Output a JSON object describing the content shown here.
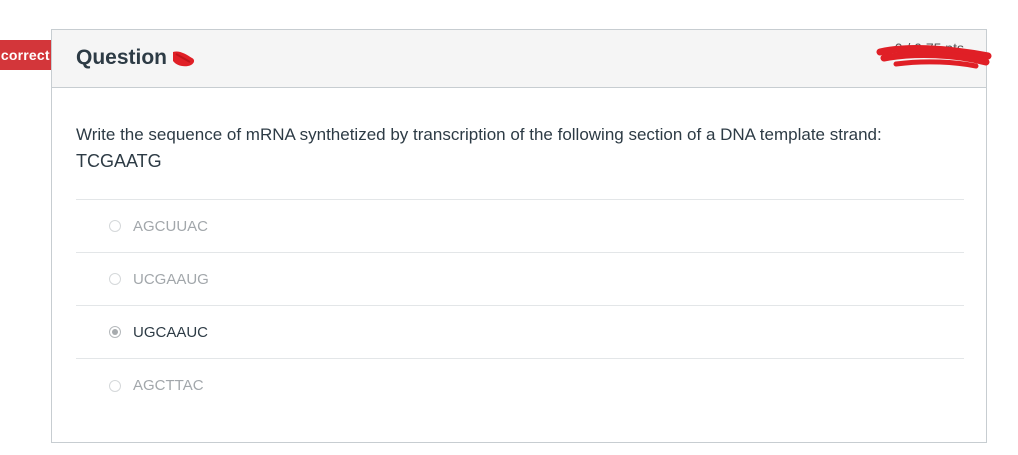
{
  "status_flag": {
    "label": "Incorrect",
    "color": "#d3363a"
  },
  "question": {
    "title": "Question",
    "points": "0 / 0.75 pts",
    "text": "Write the sequence of mRNA synthetized by transcription of the following section of a DNA template strand:",
    "sequence": "TCGAATG"
  },
  "answers": [
    {
      "label": "AGCUUAC",
      "selected": false
    },
    {
      "label": "UCGAAUG",
      "selected": false
    },
    {
      "label": "UGCAAUC",
      "selected": true
    },
    {
      "label": "AGCTTAC",
      "selected": false
    }
  ]
}
